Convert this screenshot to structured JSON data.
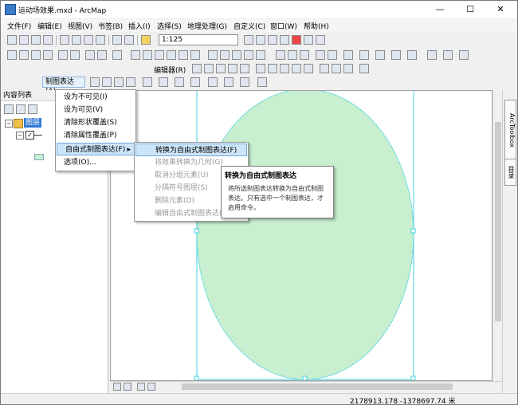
{
  "window": {
    "title": "运动场效果.mxd - ArcMap",
    "buttons": {
      "minimize": "—",
      "maximize": "☐",
      "close": "✕"
    }
  },
  "menubar": [
    "文件(F)",
    "编辑(E)",
    "视图(V)",
    "书签(B)",
    "插入(I)",
    "选择(S)",
    "地理处理(G)",
    "自定义(C)",
    "窗口(W)",
    "帮助(H)"
  ],
  "toolbar": {
    "scale_value": "1:125",
    "editor_label": "编辑器(R)",
    "representation_label": "制图表达(A)"
  },
  "toc": {
    "title": "内容列表",
    "layers_label": "图层"
  },
  "context_menu": {
    "items": [
      "设为不可见(I)",
      "设为可见(V)",
      "清除形状覆盖(S)",
      "清除属性覆盖(P)",
      "自由式制图表达(F)",
      "选项(O)..."
    ],
    "submenu_arrow": "▸"
  },
  "submenu": {
    "items": [
      "转换为自由式制图表达(F)",
      "将效果转换为几何(G)",
      "取消分组元素(U)",
      "分隔符号图层(S)",
      "删除元素(D)",
      "编辑自由式制图表达(E)"
    ]
  },
  "tooltip": {
    "title": "转换为自由式制图表达",
    "body": "将所选制图表达转换为自由式制图表达。只有选中一个制图表达，才启用命令。"
  },
  "right_tabs": [
    "ArcToolbox",
    "目录"
  ],
  "status": {
    "coordinates": "2178913.178  -1378697.74 米"
  },
  "colors": {
    "ellipse_fill": "#c8efcf",
    "selection": "#3fd0e0",
    "menu_highlight": "#cce4f7"
  }
}
